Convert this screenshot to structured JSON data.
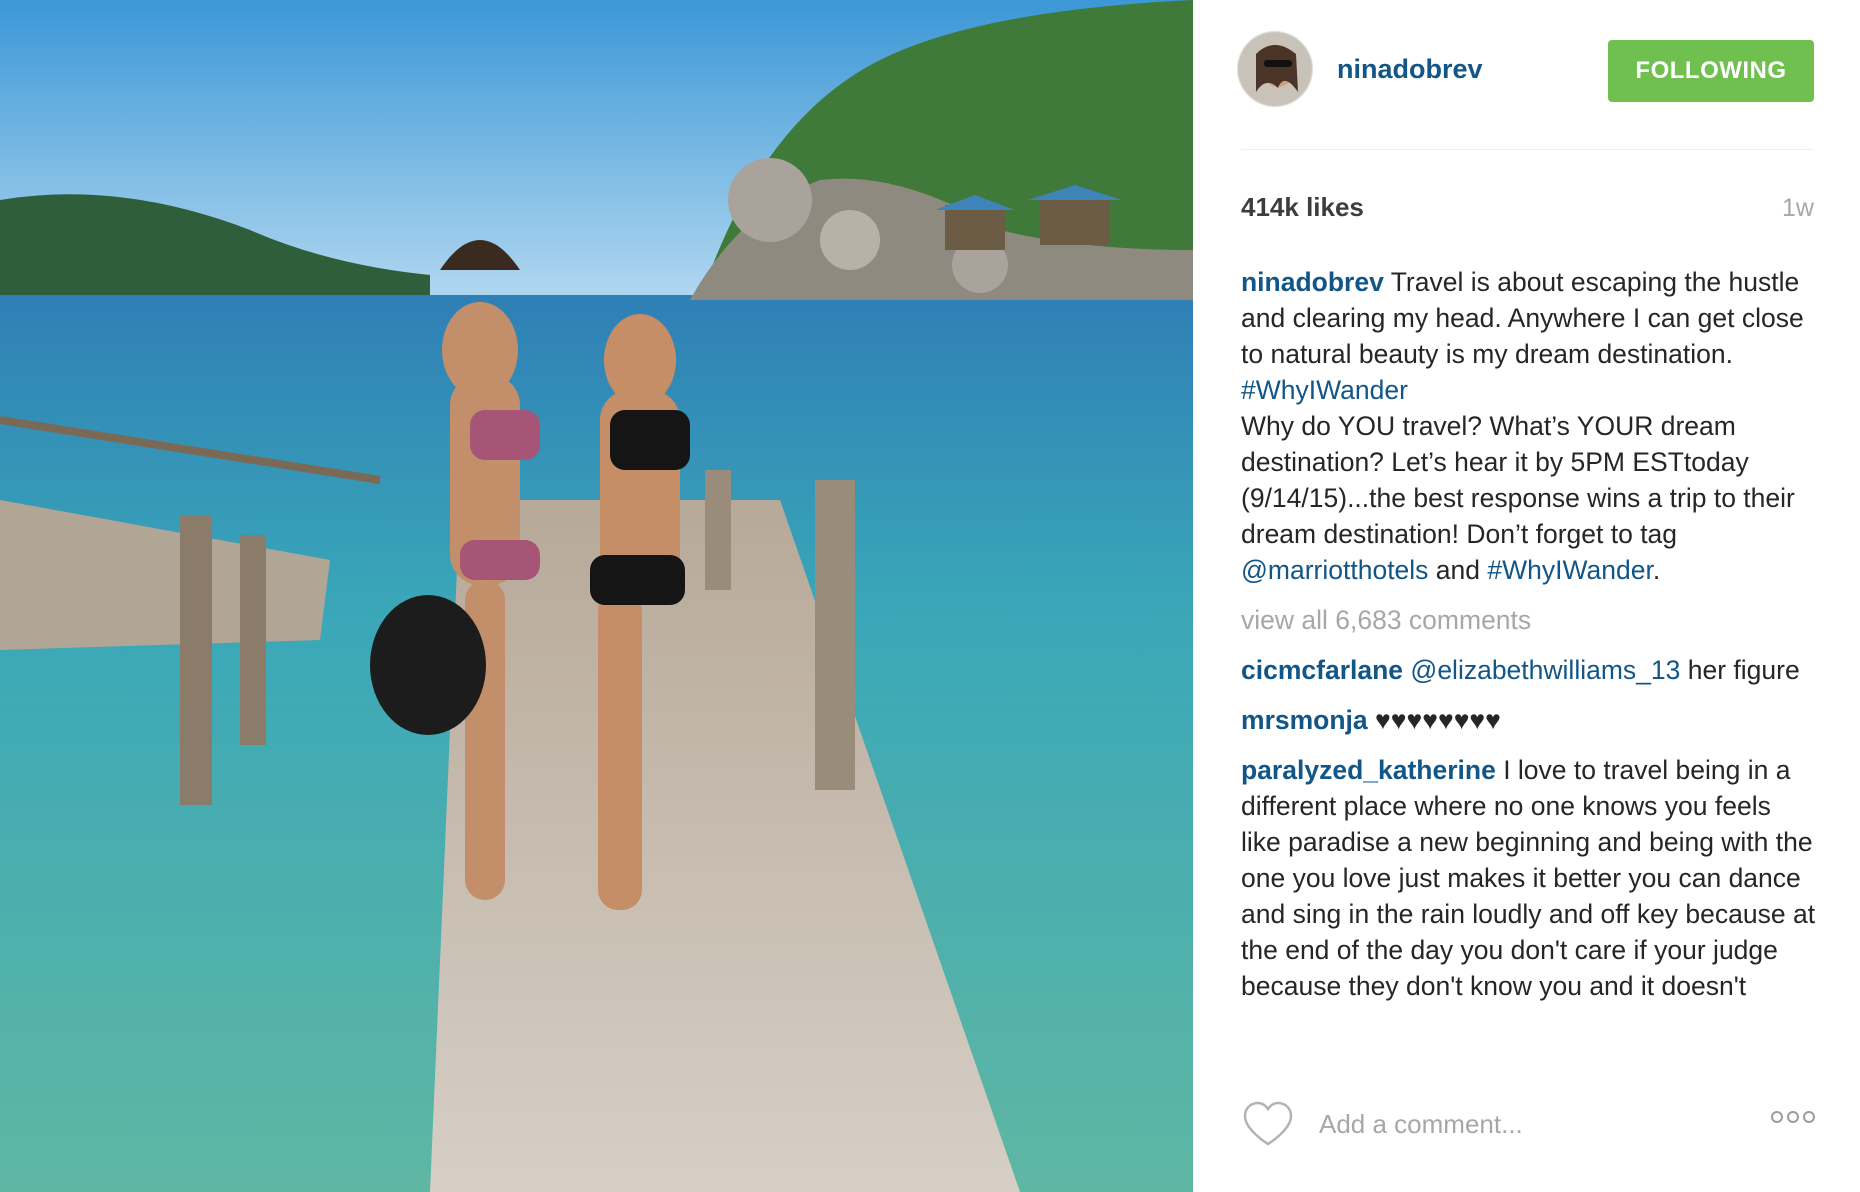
{
  "post": {
    "username": "ninadobrev",
    "follow_label": "FOLLOWING",
    "likes": "414k likes",
    "time": "1w",
    "view_all": "view all 6,683 comments",
    "add_comment_placeholder": "Add a comment...",
    "more_icon": "more-options-icon",
    "heart_icon": "heart-icon",
    "colors": {
      "username_blue": "#125688",
      "follow_green": "#70c050",
      "muted_gray": "#a5a7aa"
    }
  },
  "caption": {
    "username": "ninadobrev",
    "text1": " Travel is about escaping the hustle and clearing my head. Anywhere I can get close to natural beauty is my dream destination. ",
    "tag1": "#WhyIWander",
    "text2": "Why do YOU travel? What’s YOUR dream destination? Let’s hear it by 5PM ESTtoday (9/14/15)...the best response wins a trip to their dream destination! Don’t forget to tag ",
    "mention": "@marriotthotels",
    "text3": " and ",
    "tag2": "#WhyIWander",
    "text4": "."
  },
  "comments": [
    {
      "user": "cicmcfarlane",
      "mention": "@elizabethwilliams_13",
      "text": " her figure"
    },
    {
      "user": "mrsmonja",
      "text": " ♥♥♥♥♥♥♥♥"
    },
    {
      "user": "paralyzed_katherine",
      "text": " I love to travel being in a different place where no one knows you feels like paradise a new beginning and being with the one you love just makes it better you can dance and sing in the rain loudly and off key because at the end of the day you don't care if your judge because they don't know you and it doesn't"
    }
  ]
}
